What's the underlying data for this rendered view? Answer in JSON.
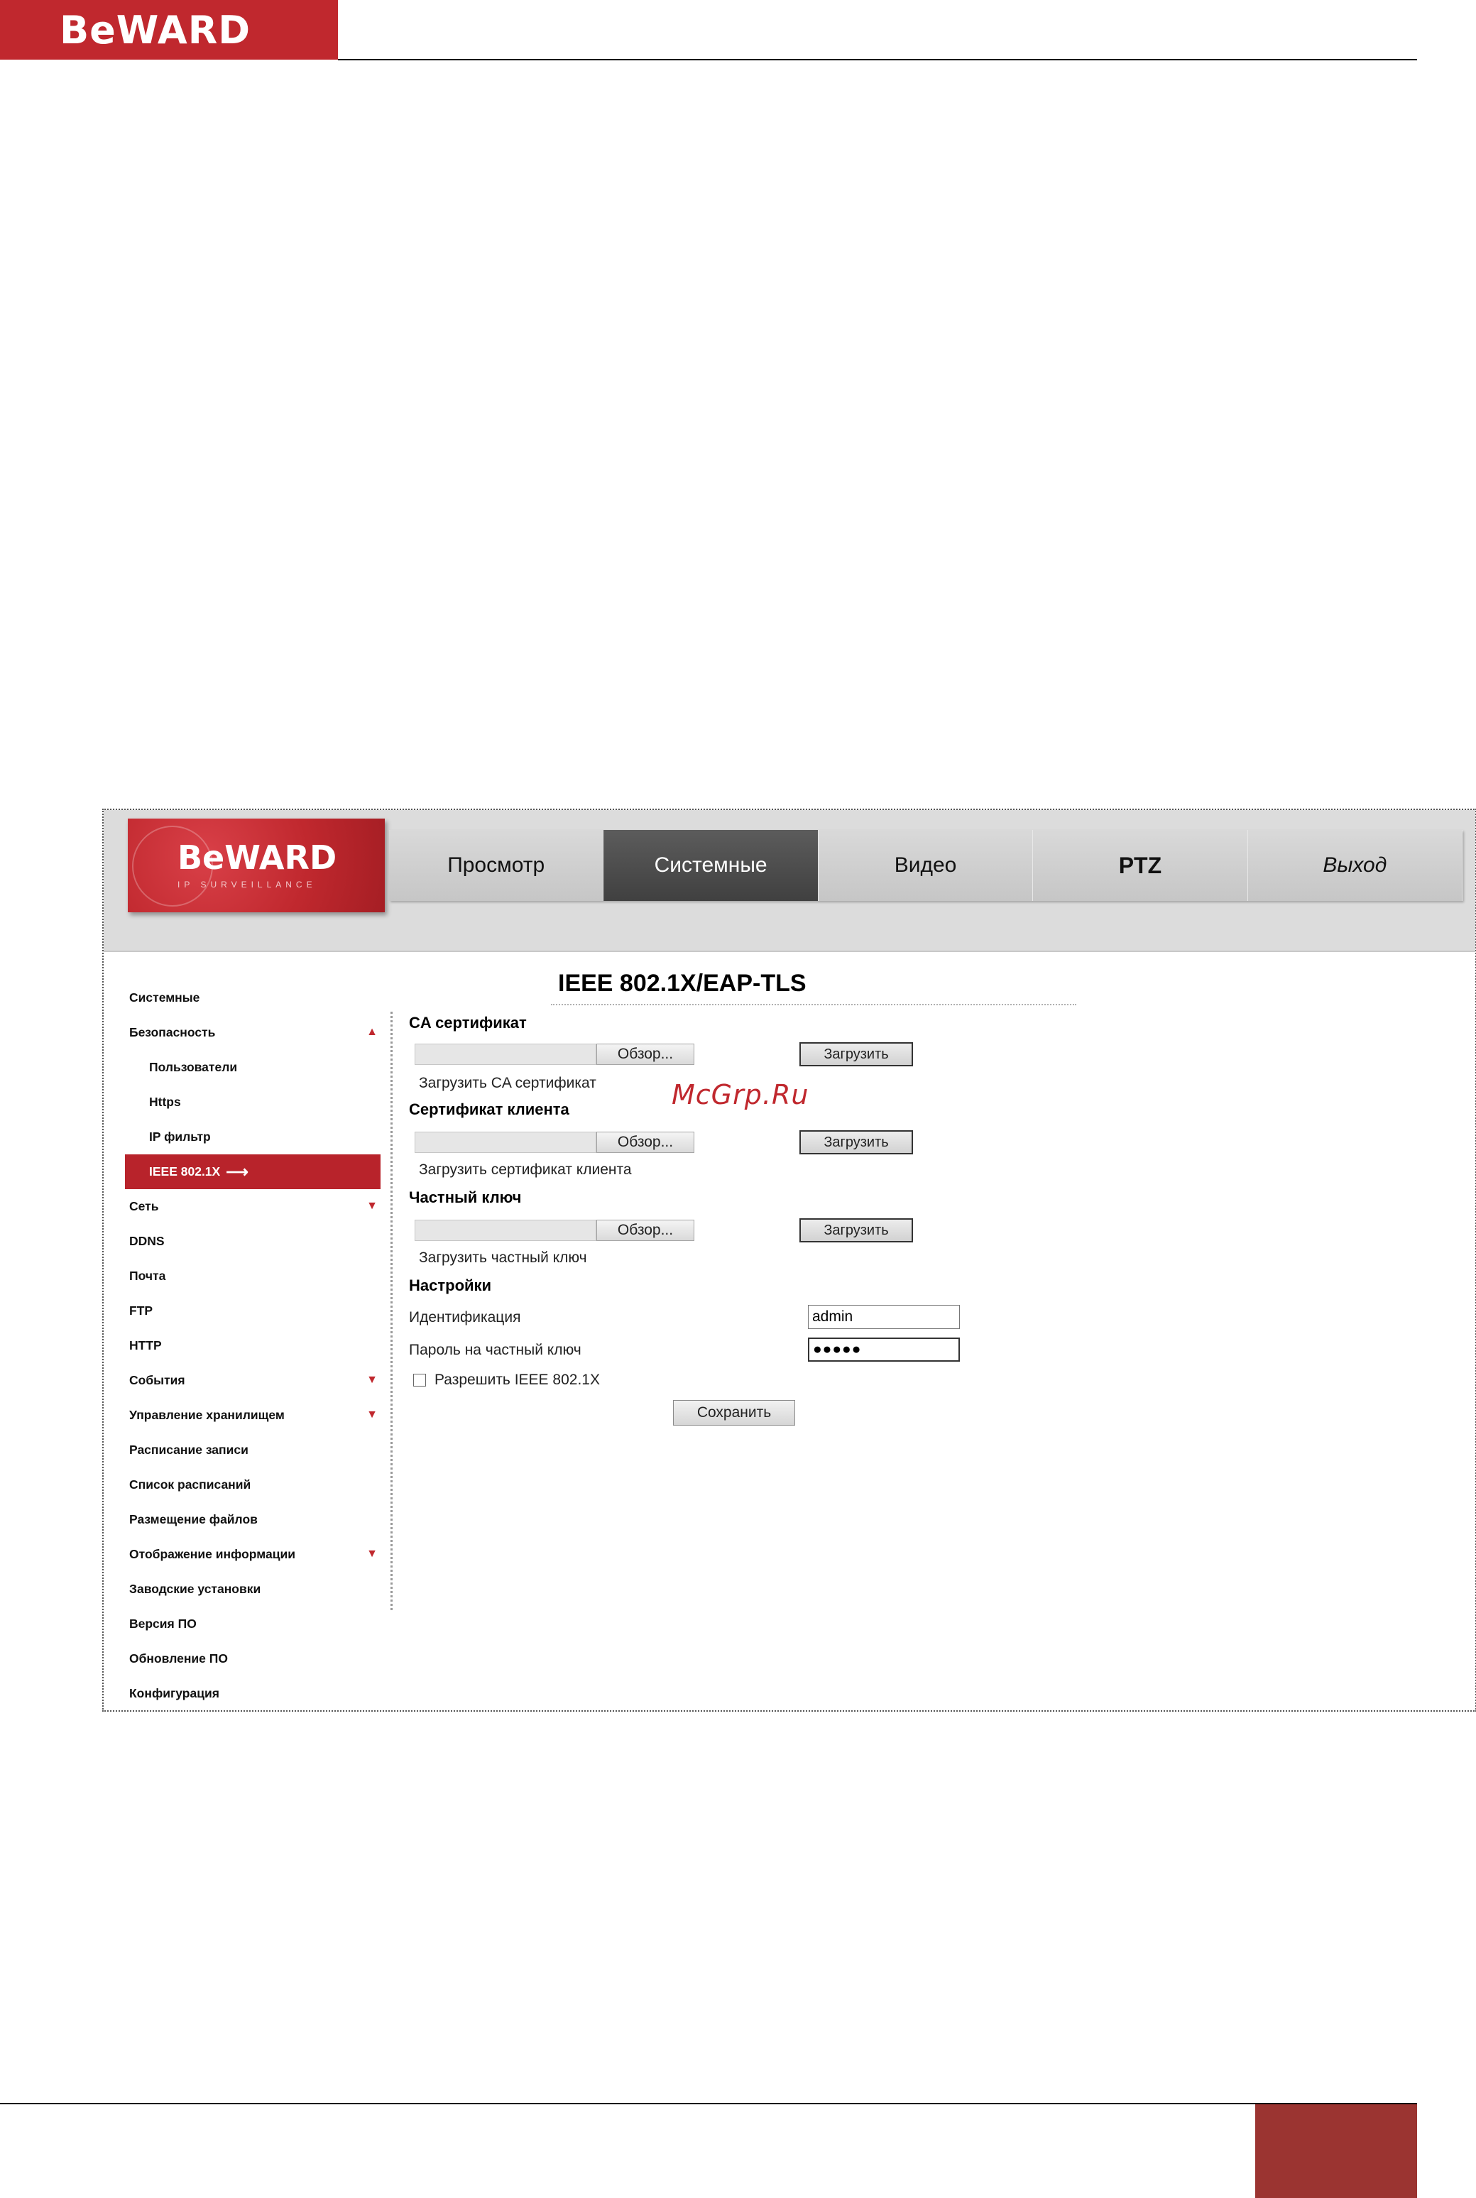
{
  "document": {
    "logo_text": "BeWARD"
  },
  "app": {
    "logo_text": "BeWARD",
    "logo_subtitle": "IP SURVEILLANCE"
  },
  "topnav": {
    "tabs": [
      {
        "label": "Просмотр"
      },
      {
        "label": "Системные"
      },
      {
        "label": "Видео"
      },
      {
        "label": "PTZ"
      },
      {
        "label": "Выход"
      }
    ],
    "active": "Системные"
  },
  "sidebar": {
    "items": [
      {
        "label": "Системные"
      },
      {
        "label": "Безопасность"
      },
      {
        "label": "Пользователи"
      },
      {
        "label": "Https"
      },
      {
        "label": "IP фильтр"
      },
      {
        "label": "IEEE 802.1X"
      },
      {
        "label": "Сеть"
      },
      {
        "label": "DDNS"
      },
      {
        "label": "Почта"
      },
      {
        "label": "FTP"
      },
      {
        "label": "HTTP"
      },
      {
        "label": "События"
      },
      {
        "label": "Управление хранилищем"
      },
      {
        "label": "Расписание записи"
      },
      {
        "label": "Список расписаний"
      },
      {
        "label": "Размещение файлов"
      },
      {
        "label": "Отображение информации"
      },
      {
        "label": "Заводские установки"
      },
      {
        "label": "Версия ПО"
      },
      {
        "label": "Обновление ПО"
      },
      {
        "label": "Конфигурация"
      }
    ],
    "active_item": "IEEE 802.1X",
    "arrow_right": "⟶",
    "arrow_up": "▲",
    "arrow_down": "▼"
  },
  "main": {
    "title": "IEEE 802.1X/EAP-TLS",
    "ca": {
      "label": "CA сертификат",
      "browse": "Обзор...",
      "upload": "Загрузить",
      "hint": "Загрузить CA сертификат"
    },
    "client": {
      "label": "Сертификат клиента",
      "browse": "Обзор...",
      "upload": "Загрузить",
      "hint": "Загрузить сертификат клиента"
    },
    "key": {
      "label": "Частный ключ",
      "browse": "Обзор...",
      "upload": "Загрузить",
      "hint": "Загрузить частный ключ"
    },
    "settings": {
      "label": "Настройки",
      "identity_label": "Идентификация",
      "identity_value": "admin",
      "password_label": "Пароль на частный ключ",
      "password_value": "●●●●●",
      "enable_label": "Разрешить IEEE 802.1X",
      "enable_checked": false,
      "save": "Сохранить"
    }
  },
  "watermark": "McGrp.Ru",
  "colors": {
    "brand_red": "#c0282e",
    "footer_red": "#9b3431",
    "active_tab": "#4a4a4a"
  }
}
